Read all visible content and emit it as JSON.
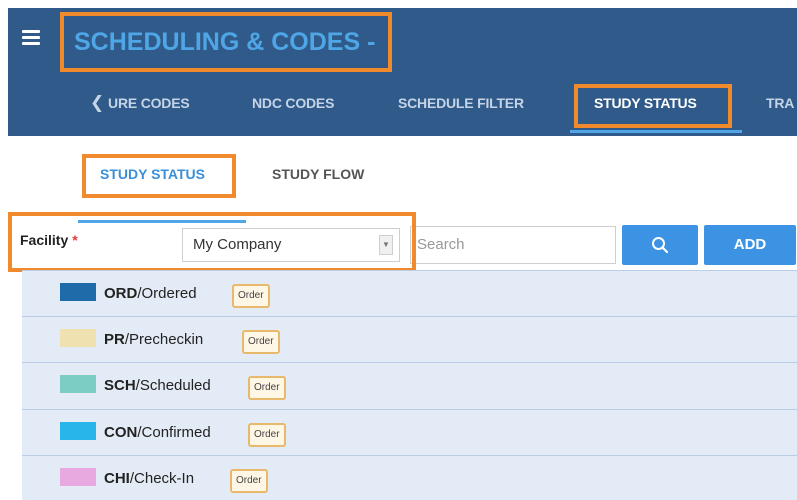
{
  "header": {
    "title": "SCHEDULING & CODES -",
    "nav": [
      {
        "label": "URE CODES",
        "active": false
      },
      {
        "label": "NDC CODES",
        "active": false
      },
      {
        "label": "SCHEDULE FILTER",
        "active": false
      },
      {
        "label": "STUDY STATUS",
        "active": true
      },
      {
        "label": "TRA",
        "active": false
      }
    ]
  },
  "subtabs": [
    {
      "label": "STUDY STATUS",
      "active": true
    },
    {
      "label": "STUDY FLOW",
      "active": false
    }
  ],
  "filter": {
    "facility_label": "Facility",
    "required_mark": "*",
    "facility_value": "My Company",
    "search_placeholder": "Search",
    "add_label": "ADD"
  },
  "statuses": [
    {
      "code": "ORD",
      "name": "Ordered",
      "color": "#1f6aa9",
      "badge": "Order"
    },
    {
      "code": "PR",
      "name": "Precheckin",
      "color": "#efe2b0",
      "badge": "Order"
    },
    {
      "code": "SCH",
      "name": "Scheduled",
      "color": "#7ccdc3",
      "badge": "Order"
    },
    {
      "code": "CON",
      "name": "Confirmed",
      "color": "#27b5ea",
      "badge": "Order"
    },
    {
      "code": "CHI",
      "name": "Check-In",
      "color": "#e8a8e0",
      "badge": "Order"
    }
  ],
  "colors": {
    "header_bg": "#2f5a8a",
    "accent": "#3d93e3",
    "highlight": "#f08a2c"
  }
}
